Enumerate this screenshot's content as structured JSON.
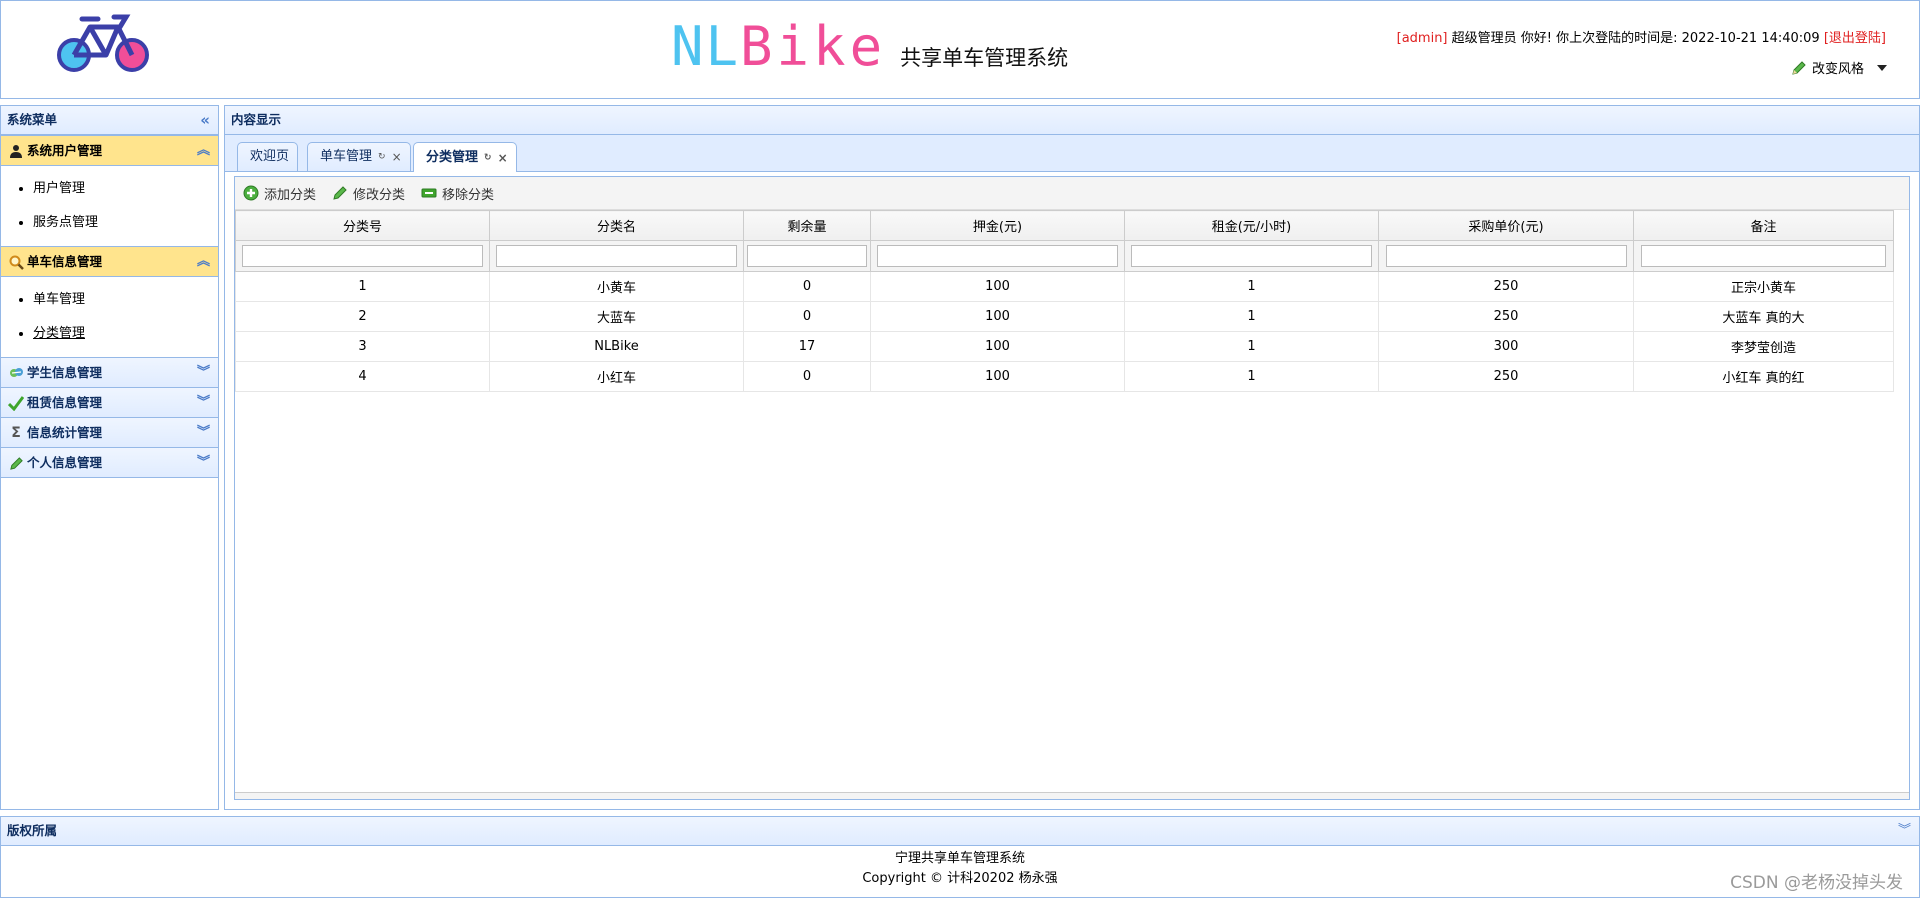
{
  "header": {
    "brand_nl": "NL",
    "brand_bike": "Bike",
    "brand_subtitle": "共享单车管理系统",
    "user_role": "[admin]",
    "greeting": " 超级管理员 你好! 你上次登陆的时间是: 2022-10-21 14:40:09 ",
    "logout_label": "[退出登陆]",
    "theme_label": "改变风格"
  },
  "sidebar": {
    "title": "系统菜单",
    "sections": [
      {
        "label": "系统用户管理",
        "icon": "user-icon",
        "expanded": true,
        "items": [
          "用户管理",
          "服务点管理"
        ]
      },
      {
        "label": "单车信息管理",
        "icon": "search-icon",
        "expanded": true,
        "items": [
          "单车管理",
          "分类管理"
        ]
      },
      {
        "label": "学生信息管理",
        "icon": "group-icon",
        "expanded": false
      },
      {
        "label": "租赁信息管理",
        "icon": "check-icon",
        "expanded": false
      },
      {
        "label": "信息统计管理",
        "icon": "sigma-icon",
        "expanded": false
      },
      {
        "label": "个人信息管理",
        "icon": "pencil-icon",
        "expanded": false
      }
    ]
  },
  "main": {
    "title": "内容显示",
    "tabs": [
      {
        "label": "欢迎页",
        "selected": false
      },
      {
        "label": "单车管理",
        "selected": false
      },
      {
        "label": "分类管理",
        "selected": true
      }
    ],
    "toolbar": {
      "add": "添加分类",
      "edit": "修改分类",
      "remove": "移除分类"
    },
    "table": {
      "columns": [
        "分类号",
        "分类名",
        "剩余量",
        "押金(元)",
        "租金(元/小时)",
        "采购单价(元)",
        "备注"
      ],
      "rows": [
        [
          "1",
          "小黄车",
          "0",
          "100",
          "1",
          "250",
          "正宗小黄车"
        ],
        [
          "2",
          "大蓝车",
          "0",
          "100",
          "1",
          "250",
          "大蓝车 真的大"
        ],
        [
          "3",
          "NLBike",
          "17",
          "100",
          "1",
          "300",
          "李梦莹创造"
        ],
        [
          "4",
          "小红车",
          "0",
          "100",
          "1",
          "250",
          "小红车 真的红"
        ]
      ]
    }
  },
  "footer": {
    "title": "版权所属",
    "line1": "宁理共享单车管理系统",
    "line2": "Copyright © 计科20202 杨永强",
    "watermark": "CSDN @老杨没掉头发"
  },
  "colors": {
    "border": "#95b8e7",
    "active_accordion": "#ffe48d",
    "admin_red": "#e02020",
    "brand_blue": "#4ec3f0",
    "brand_pink": "#f04e98"
  }
}
